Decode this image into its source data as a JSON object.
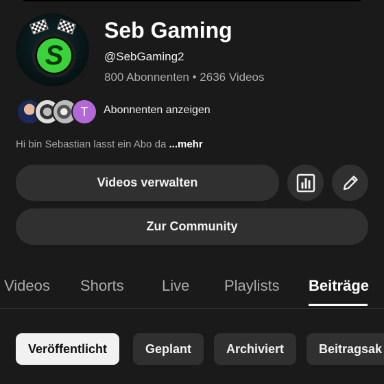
{
  "channel": {
    "name": "Seb Gaming",
    "handle": "@SebGaming2",
    "subscribers": "800 Abonnenten",
    "separator": "•",
    "videos": "2636 Videos",
    "avatar_icon": "s-logo-icon",
    "accent": "#3ad33a"
  },
  "subscribers_preview": {
    "last_initial": "T",
    "label": "Abonnenten anzeigen"
  },
  "description": {
    "text": "Hi bin Sebastian lasst ein Abo da ",
    "more": "...mehr"
  },
  "actions": {
    "manage_videos": "Videos verwalten",
    "community": "Zur Community",
    "stats_icon": "analytics-icon",
    "edit_icon": "pencil-icon"
  },
  "tabs": [
    {
      "label": "Videos"
    },
    {
      "label": "Shorts"
    },
    {
      "label": "Live"
    },
    {
      "label": "Playlists"
    },
    {
      "label": "Beiträge",
      "active": true
    }
  ],
  "chips": [
    {
      "label": "Veröffentlicht",
      "active": true
    },
    {
      "label": "Geplant"
    },
    {
      "label": "Archiviert"
    },
    {
      "label": "Beitragsak"
    }
  ]
}
